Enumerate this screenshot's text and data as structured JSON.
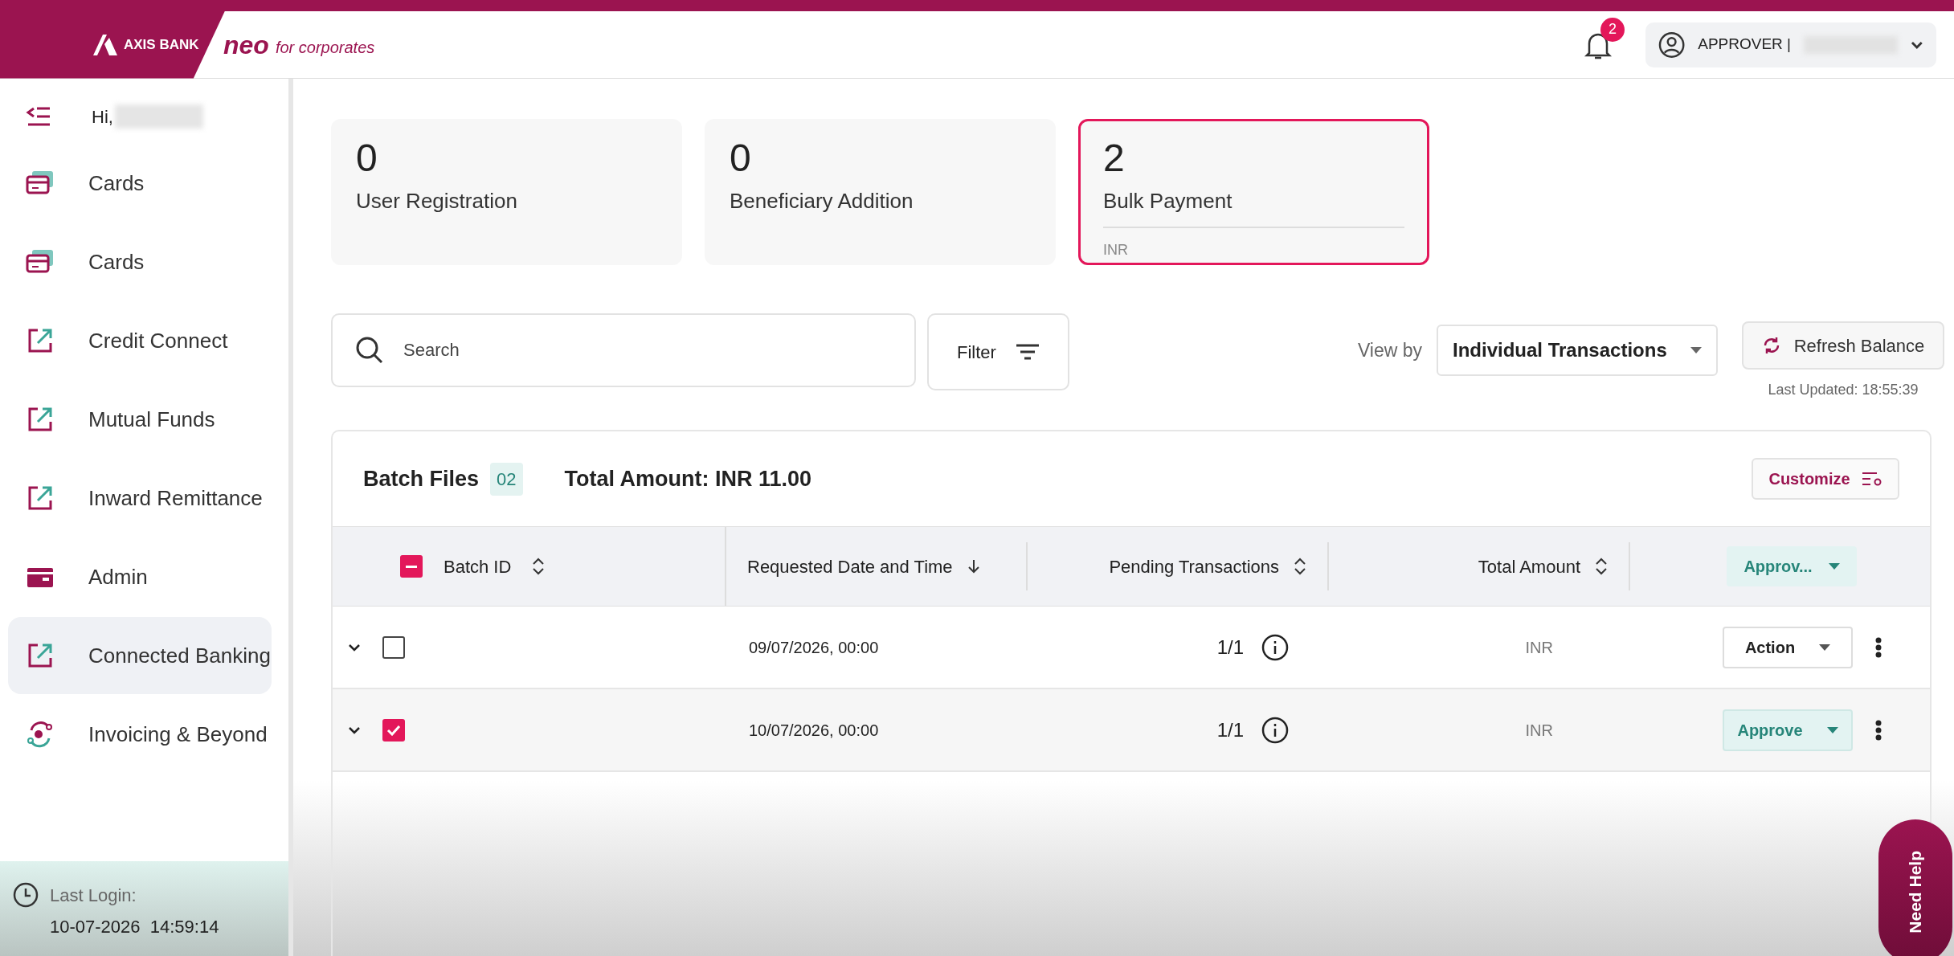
{
  "header": {
    "bank_name": "AXIS BANK",
    "product": "neo",
    "tagline": "for corporates",
    "notifications": "2",
    "role": "APPROVER |"
  },
  "sidebar": {
    "greeting": "Hi,",
    "items": [
      {
        "kind": "cards",
        "label": "Cards",
        "selected": false
      },
      {
        "kind": "cards",
        "label": "Cards",
        "selected": false
      },
      {
        "kind": "external",
        "label": "Credit Connect",
        "selected": false
      },
      {
        "kind": "external",
        "label": "Mutual Funds",
        "selected": false
      },
      {
        "kind": "external",
        "label": "Inward Remittance",
        "selected": false
      },
      {
        "kind": "admin",
        "label": "Admin",
        "selected": false
      },
      {
        "kind": "external",
        "label": "Connected Banking",
        "selected": true
      },
      {
        "kind": "invoicing",
        "label": "Invoicing & Beyond",
        "selected": false
      }
    ],
    "last_login_label": "Last Login:",
    "last_login": "10-07-2026  14:59:14"
  },
  "summary_cards": [
    {
      "count": "0",
      "label": "User Registration",
      "selected": false
    },
    {
      "count": "0",
      "label": "Beneficiary Addition",
      "selected": false
    },
    {
      "count": "2",
      "label": "Bulk Payment",
      "currency": "INR",
      "selected": true
    }
  ],
  "toolbar": {
    "search_placeholder": "Search",
    "filter": "Filter",
    "view_by_label": "View by",
    "view_by": "Individual Transactions",
    "refresh": "Refresh Balance",
    "last_updated": "Last Updated: 18:55:39"
  },
  "table": {
    "title": "Batch Files",
    "count": "02",
    "total": "Total Amount: INR 11.00",
    "customize": "Customize",
    "header_checkbox_partial": true,
    "columns": [
      {
        "label": "Batch ID",
        "kind": "sortable"
      },
      {
        "label": "Requested Date and Time",
        "kind": "sorted"
      },
      {
        "label": "Pending Transactions",
        "kind": "sortable"
      },
      {
        "label": "Total Amount",
        "kind": "sortable"
      }
    ],
    "bulk_action": "Approv...",
    "rows": [
      {
        "checked": false,
        "date": "09/07/2026, 00:00",
        "pending": "1/1",
        "amount": "INR",
        "action": {
          "kind": "plain",
          "label": "Action"
        }
      },
      {
        "checked": true,
        "date": "10/07/2026, 00:00",
        "pending": "1/1",
        "amount": "INR",
        "action": {
          "kind": "approve",
          "label": "Approve"
        }
      }
    ]
  },
  "help_button": "Need Help"
}
